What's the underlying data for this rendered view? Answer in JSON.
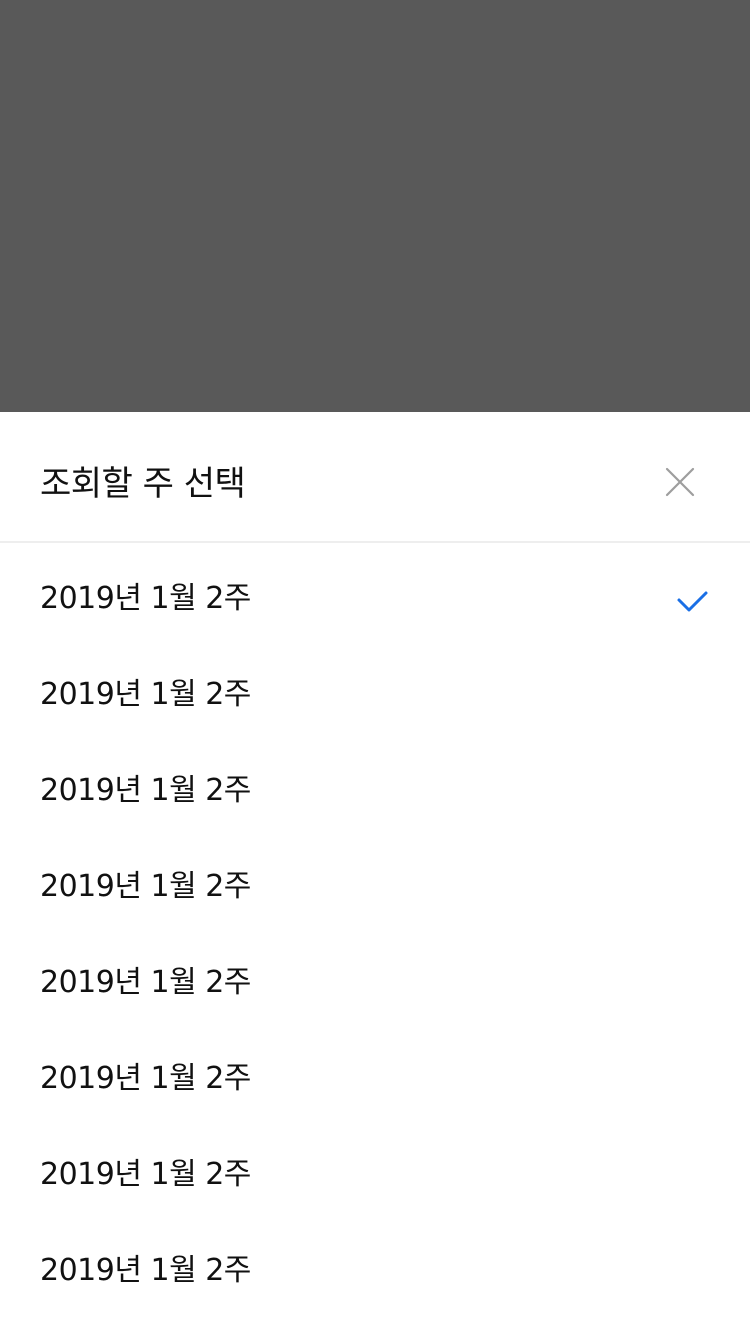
{
  "backdrop": {
    "color": "#595959"
  },
  "sheet": {
    "title": "조회할 주 선택",
    "close_icon": "close-icon",
    "accent_color": "#1a6fe6",
    "items": [
      {
        "label": "2019년 1월 2주",
        "selected": true
      },
      {
        "label": "2019년 1월 2주",
        "selected": false
      },
      {
        "label": "2019년 1월 2주",
        "selected": false
      },
      {
        "label": "2019년 1월 2주",
        "selected": false
      },
      {
        "label": "2019년 1월 2주",
        "selected": false
      },
      {
        "label": "2019년 1월 2주",
        "selected": false
      },
      {
        "label": "2019년 1월 2주",
        "selected": false
      },
      {
        "label": "2019년 1월 2주",
        "selected": false
      }
    ]
  }
}
